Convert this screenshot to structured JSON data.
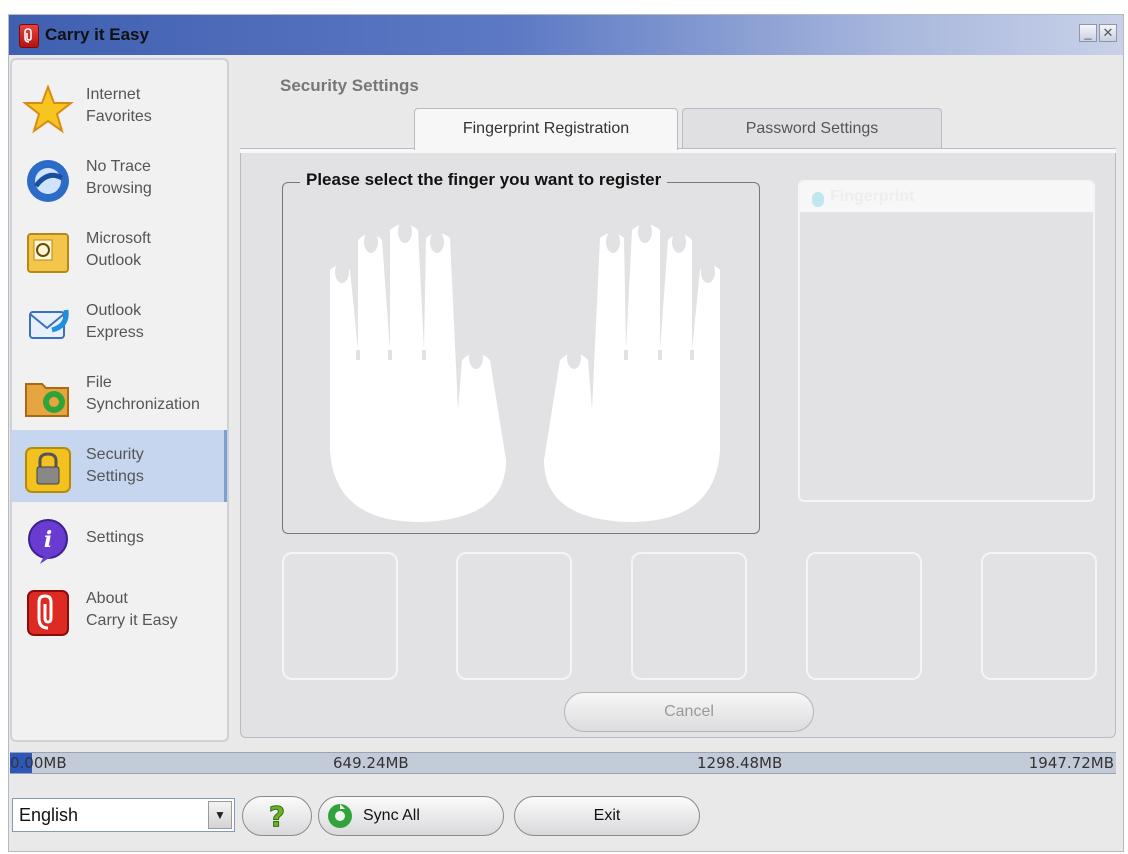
{
  "window": {
    "title": "Carry it Easy",
    "minimize_glyph": "_",
    "close_glyph": "✕"
  },
  "sidebar": {
    "items": [
      {
        "label": "Internet\nFavorites",
        "icon": "star-icon"
      },
      {
        "label": "No Trace\nBrowsing",
        "icon": "browser-icon"
      },
      {
        "label": "Microsoft\nOutlook",
        "icon": "outlook-icon"
      },
      {
        "label": "Outlook\nExpress",
        "icon": "outlook-express-icon"
      },
      {
        "label": "File\nSynchronization",
        "icon": "folder-sync-icon"
      },
      {
        "label": "Security\nSettings",
        "icon": "padlock-icon",
        "active": true
      },
      {
        "label": "Settings",
        "icon": "info-icon"
      },
      {
        "label": "About\nCarry it Easy",
        "icon": "carry-it-easy-logo-icon"
      }
    ]
  },
  "main": {
    "section_title": "Security Settings",
    "tabs": [
      {
        "label": "Fingerprint Registration",
        "active": true
      },
      {
        "label": "Password Settings",
        "active": false
      }
    ],
    "finger_prompt": "Please select the finger you want to register",
    "fingerprint_panel_title": "Fingerprint",
    "cancel_label": "Cancel"
  },
  "capacity": {
    "used_fraction": 0.02,
    "labels": [
      "0.00MB",
      "649.24MB",
      "1298.48MB",
      "1947.72MB"
    ]
  },
  "bottom": {
    "language": "English",
    "help_glyph": "?",
    "sync_label": "Sync All",
    "exit_label": "Exit"
  }
}
